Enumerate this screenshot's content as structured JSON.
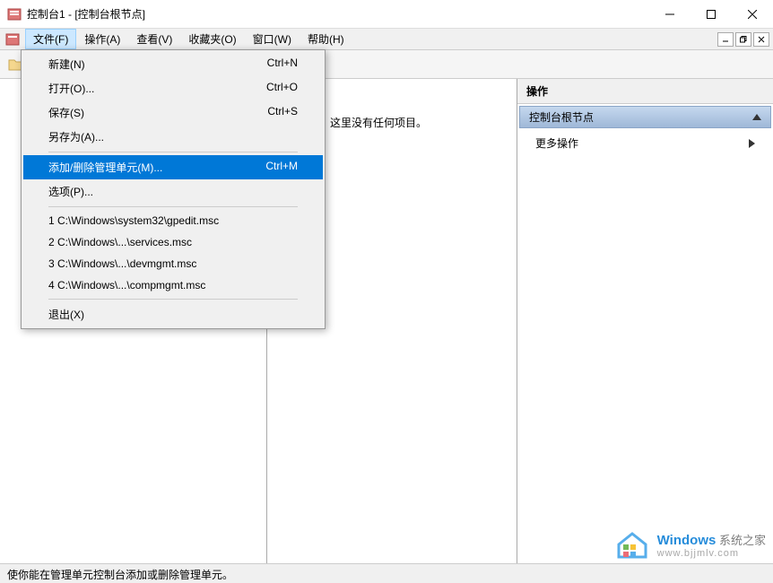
{
  "titlebar": {
    "title": "控制台1 - [控制台根节点]"
  },
  "menubar": {
    "file": "文件(F)",
    "action": "操作(A)",
    "view": "查看(V)",
    "favorites": "收藏夹(O)",
    "window": "窗口(W)",
    "help": "帮助(H)"
  },
  "dropdown": {
    "new": {
      "label": "新建(N)",
      "shortcut": "Ctrl+N"
    },
    "open": {
      "label": "打开(O)...",
      "shortcut": "Ctrl+O"
    },
    "save": {
      "label": "保存(S)",
      "shortcut": "Ctrl+S"
    },
    "saveas": {
      "label": "另存为(A)...",
      "shortcut": ""
    },
    "addremove": {
      "label": "添加/删除管理单元(M)...",
      "shortcut": "Ctrl+M"
    },
    "options": {
      "label": "选项(P)...",
      "shortcut": ""
    },
    "recent1": {
      "label": "1 C:\\Windows\\system32\\gpedit.msc",
      "shortcut": ""
    },
    "recent2": {
      "label": "2 C:\\Windows\\...\\services.msc",
      "shortcut": ""
    },
    "recent3": {
      "label": "3 C:\\Windows\\...\\devmgmt.msc",
      "shortcut": ""
    },
    "recent4": {
      "label": "4 C:\\Windows\\...\\compmgmt.msc",
      "shortcut": ""
    },
    "exit": {
      "label": "退出(X)",
      "shortcut": ""
    }
  },
  "center": {
    "empty_text": "这里没有任何项目。"
  },
  "right": {
    "header": "操作",
    "section": "控制台根节点",
    "more": "更多操作"
  },
  "statusbar": {
    "text": "使你能在管理单元控制台添加或删除管理单元。"
  },
  "watermark": {
    "brand": "Windows",
    "tagline": "系统之家",
    "url": "www.bjjmlv.com"
  }
}
